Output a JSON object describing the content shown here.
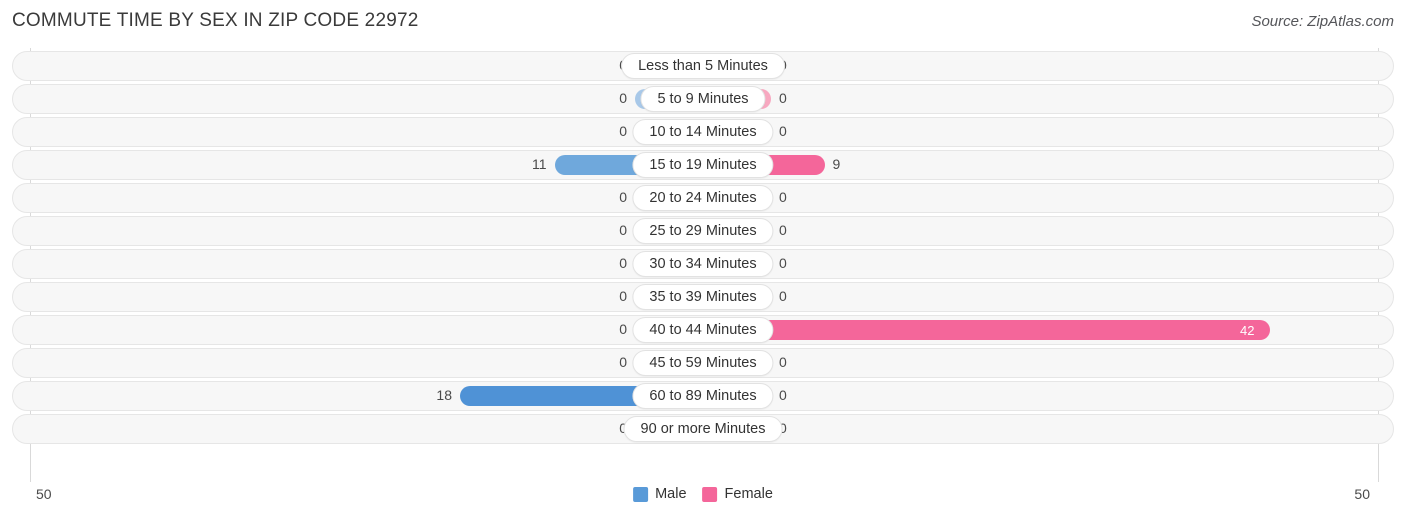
{
  "header": {
    "title": "COMMUTE TIME BY SEX IN ZIP CODE 22972",
    "source": "Source: ZipAtlas.com"
  },
  "axis": {
    "left_tick": "50",
    "right_tick": "50"
  },
  "legend": {
    "items": [
      {
        "label": "Male",
        "color": "#599ad8"
      },
      {
        "label": "Female",
        "color": "#f4669a"
      }
    ]
  },
  "colors": {
    "male_active": "#6fa8dc",
    "male_strong": "#4f92d6",
    "male_zero": "#a8c8e8",
    "female_active": "#f4669a",
    "female_zero": "#f7a8c0",
    "row_background": "#f7f7f7",
    "row_border": "#e6e6e6"
  },
  "chart_data": {
    "type": "bar",
    "title": "COMMUTE TIME BY SEX IN ZIP CODE 22972",
    "subtitle": "",
    "orientation": "horizontal-diverging",
    "xlabel": "",
    "ylabel": "",
    "axis_max": 50,
    "xlim": [
      -50,
      50
    ],
    "grid": false,
    "legend_position": "bottom-center",
    "categories": [
      "Less than 5 Minutes",
      "5 to 9 Minutes",
      "10 to 14 Minutes",
      "15 to 19 Minutes",
      "20 to 24 Minutes",
      "25 to 29 Minutes",
      "30 to 34 Minutes",
      "35 to 39 Minutes",
      "40 to 44 Minutes",
      "45 to 59 Minutes",
      "60 to 89 Minutes",
      "90 or more Minutes"
    ],
    "series": [
      {
        "name": "Male",
        "side": "left",
        "values": [
          0,
          0,
          0,
          11,
          0,
          0,
          0,
          0,
          0,
          0,
          18,
          0
        ]
      },
      {
        "name": "Female",
        "side": "right",
        "values": [
          0,
          0,
          0,
          9,
          0,
          0,
          0,
          0,
          42,
          0,
          0,
          0
        ]
      }
    ]
  },
  "rows": [
    {
      "category": "Less than 5 Minutes",
      "male": "0",
      "female": "0",
      "male_value": 0,
      "female_value": 0
    },
    {
      "category": "5 to 9 Minutes",
      "male": "0",
      "female": "0",
      "male_value": 0,
      "female_value": 0
    },
    {
      "category": "10 to 14 Minutes",
      "male": "0",
      "female": "0",
      "male_value": 0,
      "female_value": 0
    },
    {
      "category": "15 to 19 Minutes",
      "male": "11",
      "female": "9",
      "male_value": 11,
      "female_value": 9
    },
    {
      "category": "20 to 24 Minutes",
      "male": "0",
      "female": "0",
      "male_value": 0,
      "female_value": 0
    },
    {
      "category": "25 to 29 Minutes",
      "male": "0",
      "female": "0",
      "male_value": 0,
      "female_value": 0
    },
    {
      "category": "30 to 34 Minutes",
      "male": "0",
      "female": "0",
      "male_value": 0,
      "female_value": 0
    },
    {
      "category": "35 to 39 Minutes",
      "male": "0",
      "female": "0",
      "male_value": 0,
      "female_value": 0
    },
    {
      "category": "40 to 44 Minutes",
      "male": "0",
      "female": "42",
      "male_value": 0,
      "female_value": 42
    },
    {
      "category": "45 to 59 Minutes",
      "male": "0",
      "female": "0",
      "male_value": 0,
      "female_value": 0
    },
    {
      "category": "60 to 89 Minutes",
      "male": "18",
      "female": "0",
      "male_value": 18,
      "female_value": 0
    },
    {
      "category": "90 or more Minutes",
      "male": "0",
      "female": "0",
      "male_value": 0,
      "female_value": 0
    }
  ]
}
